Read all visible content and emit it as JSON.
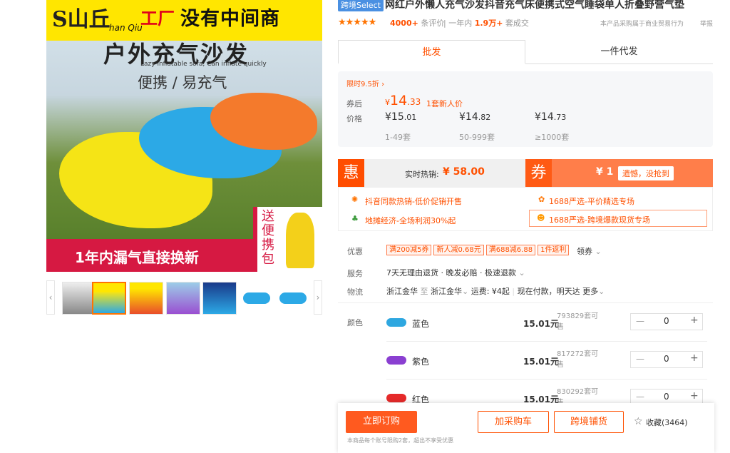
{
  "gallery": {
    "logo_big": "S山丘",
    "logo_sub": "han Qiu",
    "factory": "工厂",
    "slogan": "没有中间商",
    "headline": "户外充气沙发",
    "tagline_en": "Lazy inflatable sofa, Can inflate quickly",
    "subheadline": "便携 / 易充气",
    "bottom_banner": "1年内漏气直接换新",
    "gift_text": "送便携包",
    "prev": "‹",
    "next": "›"
  },
  "product": {
    "badge": "跨境Select",
    "title": "网红户外懒人充气沙发抖音充气床便携式空气睡袋单人折叠野营气垫",
    "rating_stars": "★★★★★",
    "reviews_count": "4000+",
    "reviews_label": "条评价",
    "sales_prefix": "一年内",
    "sales_count": "1.9万+",
    "sales_label": "套成交",
    "notice": "本产品采购属于商业贸易行为",
    "report": "举报"
  },
  "tabs": [
    {
      "label": "批发",
      "active": true
    },
    {
      "label": "一件代发",
      "active": false
    }
  ],
  "pricing": {
    "promo": "限时9.5折 ›",
    "after_coupon_label": "券后",
    "after_coupon_currency": "¥",
    "after_coupon_int": "14",
    "after_coupon_dec": ".33",
    "new_user_price": "1套新人价",
    "price_label": "价格",
    "tiers": [
      {
        "cur": "¥",
        "int": "15",
        "dec": ".01",
        "range": "1-49套"
      },
      {
        "cur": "¥",
        "int": "14",
        "dec": ".82",
        "range": "50-999套"
      },
      {
        "cur": "¥",
        "int": "14",
        "dec": ".73",
        "range": "≥1000套"
      }
    ]
  },
  "deal": {
    "hui": "惠",
    "hot_label": "实时热销:",
    "hot_price": "¥ 58.00",
    "quan": "券",
    "coupon_value": "¥ 1",
    "coupon_status": "遗憾，没抢到"
  },
  "features": [
    "抖音同款热销-低价促销开售",
    "1688严选-平价精选专场",
    "地摊经济-全场利润30%起",
    "1688严选-跨境爆款现货专场"
  ],
  "info": {
    "discount_label": "优惠",
    "discount_chips": [
      "满200减5券",
      "新人减0.68元",
      "满688减6.88",
      "1件返利"
    ],
    "get_coupon": "领券",
    "service_label": "服务",
    "service_text": "7天无理由退货 · 晚发必赔 · 极速退款",
    "logistics_label": "物流",
    "from": "浙江金华",
    "to_word": "至",
    "to": "浙江金华",
    "freight": "运费: ¥4起",
    "ship": "现在付款，明天达",
    "more": "更多"
  },
  "skus": {
    "color_label": "颜色",
    "items": [
      {
        "name": "蓝色",
        "price": "15.01元",
        "stock": "793829套可售",
        "qty": "0",
        "color": "#2ea7e0"
      },
      {
        "name": "紫色",
        "price": "15.01元",
        "stock": "817272套可售",
        "qty": "0",
        "color": "#8a3fd1"
      },
      {
        "name": "红色",
        "price": "15.01元",
        "stock": "830292套可售",
        "qty": "0",
        "color": "#e52a2a"
      }
    ],
    "minus": "—",
    "plus": "+"
  },
  "actions": {
    "buy_now": "立即订购",
    "add_cart": "加采购车",
    "cross_border": "跨境铺货",
    "favorite_icon": "☆",
    "favorite": "收藏(3464)",
    "limit_note": "本商品每个账号限购2套，超出不享受优惠"
  }
}
